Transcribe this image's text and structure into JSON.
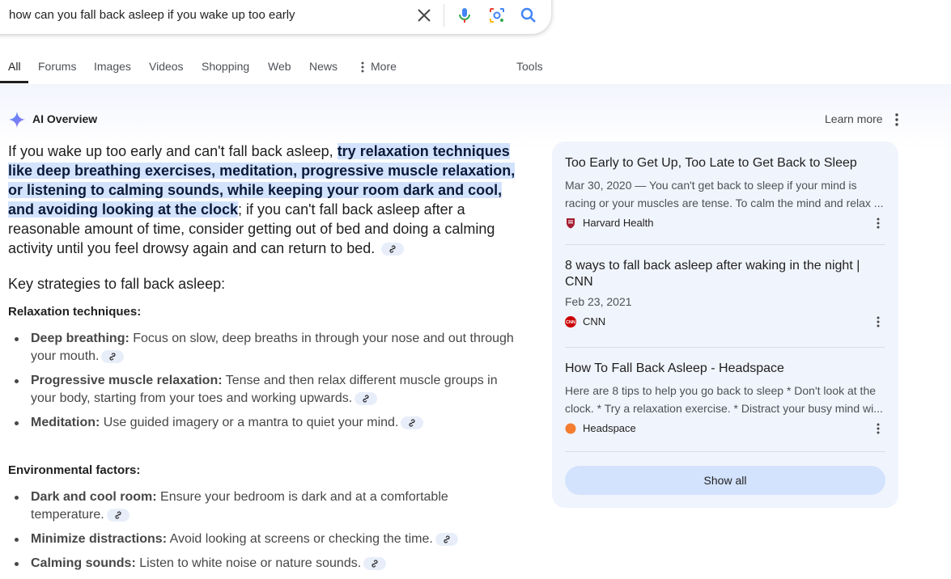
{
  "search": {
    "query": "how can you fall back asleep if you wake up too early"
  },
  "tabs": [
    {
      "label": "All",
      "active": true
    },
    {
      "label": "Forums"
    },
    {
      "label": "Images"
    },
    {
      "label": "Videos"
    },
    {
      "label": "Shopping"
    },
    {
      "label": "Web"
    },
    {
      "label": "News"
    },
    {
      "label": "More"
    }
  ],
  "tools_label": "Tools",
  "ai_overview": {
    "title": "AI Overview",
    "learn_more": "Learn more",
    "lead_before": "If you wake up too early and can't fall back asleep, ",
    "lead_highlight": "try relaxation techniques like deep breathing exercises, meditation, progressive muscle relaxation, or listening to calming sounds, while keeping your room dark and cool, and avoiding looking at the clock",
    "lead_after": "; if you can't fall back asleep after a reasonable amount of time, consider getting out of bed and doing a calming activity until you feel drowsy again and can return to bed.",
    "strategies_heading": "Key strategies to fall back asleep:",
    "sections": [
      {
        "heading": "Relaxation techniques:",
        "items": [
          {
            "term": "Deep breathing:",
            "text": " Focus on slow, deep breaths in through your nose and out through your mouth."
          },
          {
            "term": "Progressive muscle relaxation:",
            "text": " Tense and then relax different muscle groups in your body, starting from your toes and working upwards."
          },
          {
            "term": "Meditation:",
            "text": " Use guided imagery or a mantra to quiet your mind."
          }
        ]
      },
      {
        "heading": "Environmental factors:",
        "items": [
          {
            "term": "Dark and cool room:",
            "text": " Ensure your bedroom is dark and at a comfortable temperature."
          },
          {
            "term": "Minimize distractions:",
            "text": " Avoid looking at screens or checking the time."
          },
          {
            "term": "Calming sounds:",
            "text": " Listen to white noise or nature sounds."
          }
        ]
      }
    ]
  },
  "sources": [
    {
      "title": "Too Early to Get Up, Too Late to Get Back to Sleep",
      "snippet_line1": "Mar 30, 2020 — You can't get back to sleep if your mind is",
      "snippet_line2": "racing or your muscles are tense. To calm the mind and relax ...",
      "site": "Harvard Health",
      "favicon_color": "#a51c30"
    },
    {
      "title": "8 ways to fall back asleep after waking in the night | CNN",
      "date": "Feb 23, 2021",
      "site": "CNN",
      "favicon_color": "#cc0000"
    },
    {
      "title": "How To Fall Back Asleep - Headspace",
      "snippet_line1": "Here are 8 tips to help you go back to sleep * Don't look at the",
      "snippet_line2": "clock. * Try a relaxation exercise. * Distract your busy mind wi...",
      "site": "Headspace",
      "favicon_color": "#f47d31"
    }
  ],
  "show_all": "Show all",
  "colors": {
    "highlight": "#d3e3fd",
    "panel": "#f0f4fc",
    "accent_blue": "#4285f4"
  }
}
